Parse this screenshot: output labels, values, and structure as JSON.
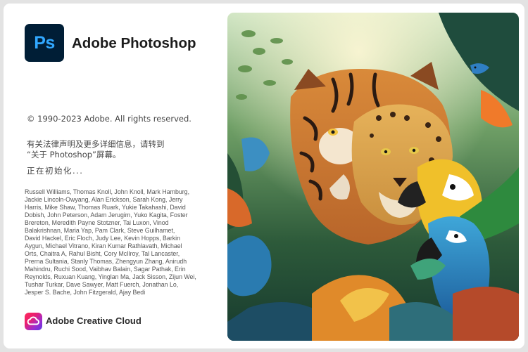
{
  "app": {
    "icon_text": "Ps",
    "title": "Adobe Photoshop"
  },
  "copyright": "© 1990-2023 Adobe. All rights reserved.",
  "legal": [
    "有关法律声明及更多详细信息，请转到",
    "“关于 Photoshop”屏幕。"
  ],
  "status": "正在初始化...",
  "credits": [
    "Russell Williams, Thomas Knoll, John Knoll, Mark Hamburg,",
    "Jackie Lincoln-Owyang, Alan Erickson, Sarah Kong, Jerry",
    "Harris, Mike Shaw, Thomas Ruark, Yukie Takahashi, David",
    "Dobish, John Peterson, Adam Jerugim, Yuko Kagita, Foster",
    "Brereton, Meredith Payne Stotzner, Tai Luxon, Vinod",
    "Balakrishnan, Maria Yap, Pam Clark, Steve Guilhamet,",
    "David Hackel, Eric Floch, Judy Lee, Kevin Hopps, Barkin",
    "Aygun, Michael Vitrano, Kiran Kumar Rathlavath, Michael",
    "Orts, Chaitra A, Rahul Bisht, Cory McIlroy, Tal Lancaster,",
    "Prerna Sultania, Stanly Thomas, Zhengyun Zhang, Anirudh",
    "Mahindru, Ruchi Sood, Vaibhav Balain, Sagar Pathak, Erin",
    "Reynolds, Ruxuan Kuang, Yinglan Ma, Jack Sisson, Zijun Wei,",
    "Tushar Turkar, Dave Sawyer, Matt Fuerch, Jonathan Lo,",
    "Jesper S. Bache, John Fitzgerald, Ajay Bedi"
  ],
  "footer": {
    "label": "Adobe Creative Cloud",
    "icon": "creative-cloud-icon"
  },
  "colors": {
    "ps_bg": "#001e36",
    "ps_accent": "#31a8ff"
  }
}
